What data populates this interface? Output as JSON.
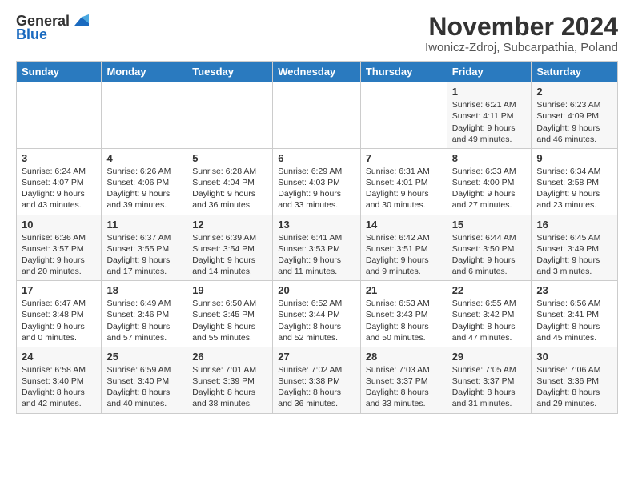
{
  "header": {
    "logo_line1": "General",
    "logo_line2": "Blue",
    "main_title": "November 2024",
    "subtitle": "Iwonicz-Zdroj, Subcarpathia, Poland"
  },
  "columns": [
    "Sunday",
    "Monday",
    "Tuesday",
    "Wednesday",
    "Thursday",
    "Friday",
    "Saturday"
  ],
  "weeks": [
    [
      {
        "day": "",
        "info": ""
      },
      {
        "day": "",
        "info": ""
      },
      {
        "day": "",
        "info": ""
      },
      {
        "day": "",
        "info": ""
      },
      {
        "day": "",
        "info": ""
      },
      {
        "day": "1",
        "info": "Sunrise: 6:21 AM\nSunset: 4:11 PM\nDaylight: 9 hours\nand 49 minutes."
      },
      {
        "day": "2",
        "info": "Sunrise: 6:23 AM\nSunset: 4:09 PM\nDaylight: 9 hours\nand 46 minutes."
      }
    ],
    [
      {
        "day": "3",
        "info": "Sunrise: 6:24 AM\nSunset: 4:07 PM\nDaylight: 9 hours\nand 43 minutes."
      },
      {
        "day": "4",
        "info": "Sunrise: 6:26 AM\nSunset: 4:06 PM\nDaylight: 9 hours\nand 39 minutes."
      },
      {
        "day": "5",
        "info": "Sunrise: 6:28 AM\nSunset: 4:04 PM\nDaylight: 9 hours\nand 36 minutes."
      },
      {
        "day": "6",
        "info": "Sunrise: 6:29 AM\nSunset: 4:03 PM\nDaylight: 9 hours\nand 33 minutes."
      },
      {
        "day": "7",
        "info": "Sunrise: 6:31 AM\nSunset: 4:01 PM\nDaylight: 9 hours\nand 30 minutes."
      },
      {
        "day": "8",
        "info": "Sunrise: 6:33 AM\nSunset: 4:00 PM\nDaylight: 9 hours\nand 27 minutes."
      },
      {
        "day": "9",
        "info": "Sunrise: 6:34 AM\nSunset: 3:58 PM\nDaylight: 9 hours\nand 23 minutes."
      }
    ],
    [
      {
        "day": "10",
        "info": "Sunrise: 6:36 AM\nSunset: 3:57 PM\nDaylight: 9 hours\nand 20 minutes."
      },
      {
        "day": "11",
        "info": "Sunrise: 6:37 AM\nSunset: 3:55 PM\nDaylight: 9 hours\nand 17 minutes."
      },
      {
        "day": "12",
        "info": "Sunrise: 6:39 AM\nSunset: 3:54 PM\nDaylight: 9 hours\nand 14 minutes."
      },
      {
        "day": "13",
        "info": "Sunrise: 6:41 AM\nSunset: 3:53 PM\nDaylight: 9 hours\nand 11 minutes."
      },
      {
        "day": "14",
        "info": "Sunrise: 6:42 AM\nSunset: 3:51 PM\nDaylight: 9 hours\nand 9 minutes."
      },
      {
        "day": "15",
        "info": "Sunrise: 6:44 AM\nSunset: 3:50 PM\nDaylight: 9 hours\nand 6 minutes."
      },
      {
        "day": "16",
        "info": "Sunrise: 6:45 AM\nSunset: 3:49 PM\nDaylight: 9 hours\nand 3 minutes."
      }
    ],
    [
      {
        "day": "17",
        "info": "Sunrise: 6:47 AM\nSunset: 3:48 PM\nDaylight: 9 hours\nand 0 minutes."
      },
      {
        "day": "18",
        "info": "Sunrise: 6:49 AM\nSunset: 3:46 PM\nDaylight: 8 hours\nand 57 minutes."
      },
      {
        "day": "19",
        "info": "Sunrise: 6:50 AM\nSunset: 3:45 PM\nDaylight: 8 hours\nand 55 minutes."
      },
      {
        "day": "20",
        "info": "Sunrise: 6:52 AM\nSunset: 3:44 PM\nDaylight: 8 hours\nand 52 minutes."
      },
      {
        "day": "21",
        "info": "Sunrise: 6:53 AM\nSunset: 3:43 PM\nDaylight: 8 hours\nand 50 minutes."
      },
      {
        "day": "22",
        "info": "Sunrise: 6:55 AM\nSunset: 3:42 PM\nDaylight: 8 hours\nand 47 minutes."
      },
      {
        "day": "23",
        "info": "Sunrise: 6:56 AM\nSunset: 3:41 PM\nDaylight: 8 hours\nand 45 minutes."
      }
    ],
    [
      {
        "day": "24",
        "info": "Sunrise: 6:58 AM\nSunset: 3:40 PM\nDaylight: 8 hours\nand 42 minutes."
      },
      {
        "day": "25",
        "info": "Sunrise: 6:59 AM\nSunset: 3:40 PM\nDaylight: 8 hours\nand 40 minutes."
      },
      {
        "day": "26",
        "info": "Sunrise: 7:01 AM\nSunset: 3:39 PM\nDaylight: 8 hours\nand 38 minutes."
      },
      {
        "day": "27",
        "info": "Sunrise: 7:02 AM\nSunset: 3:38 PM\nDaylight: 8 hours\nand 36 minutes."
      },
      {
        "day": "28",
        "info": "Sunrise: 7:03 AM\nSunset: 3:37 PM\nDaylight: 8 hours\nand 33 minutes."
      },
      {
        "day": "29",
        "info": "Sunrise: 7:05 AM\nSunset: 3:37 PM\nDaylight: 8 hours\nand 31 minutes."
      },
      {
        "day": "30",
        "info": "Sunrise: 7:06 AM\nSunset: 3:36 PM\nDaylight: 8 hours\nand 29 minutes."
      }
    ]
  ]
}
